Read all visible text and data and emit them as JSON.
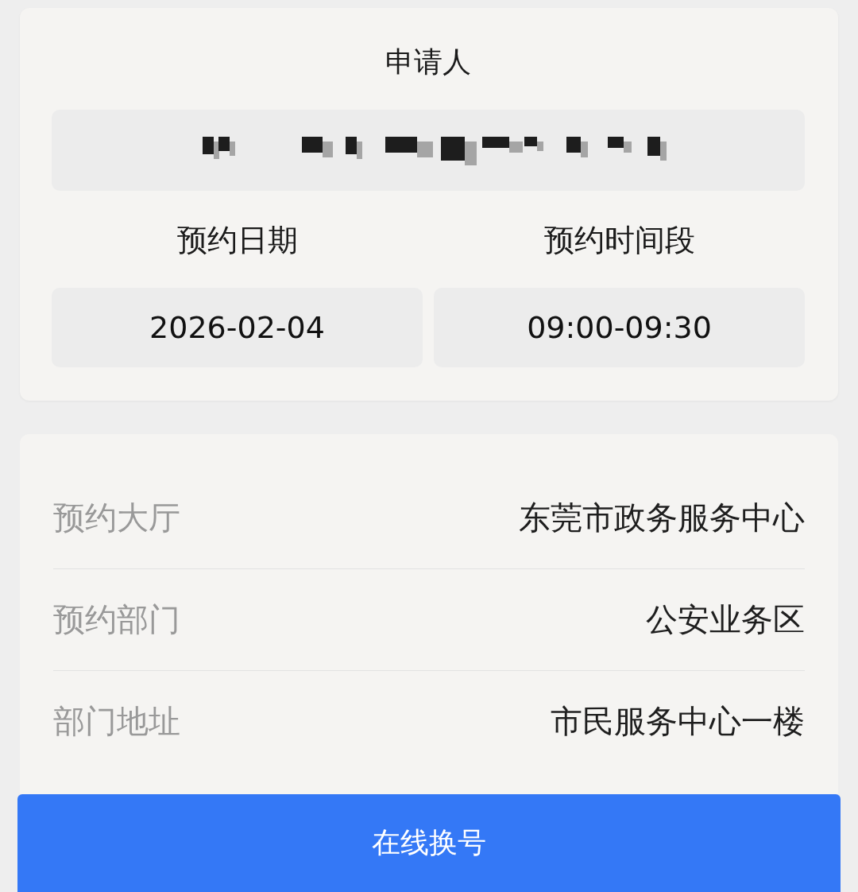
{
  "applicant": {
    "label": "申请人",
    "value_redacted": true
  },
  "slot": {
    "fields": [
      {
        "label": "预约日期",
        "value": "2026-02-04"
      },
      {
        "label": "预约时间段",
        "value": "09:00-09:30"
      }
    ]
  },
  "details": [
    {
      "label": "预约大厅",
      "value": "东莞市政务服务中心"
    },
    {
      "label": "预约部门",
      "value": "公安业务区"
    },
    {
      "label": "部门地址",
      "value": "市民服务中心一楼"
    }
  ],
  "action_button": "在线换号"
}
